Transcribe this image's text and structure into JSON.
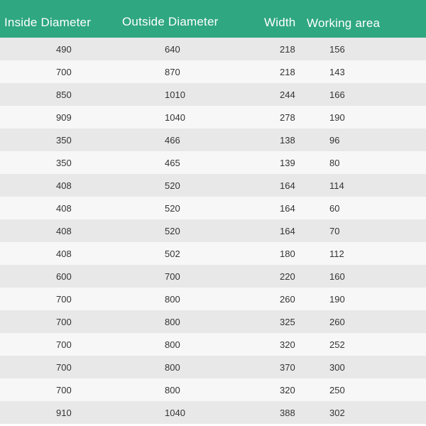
{
  "table": {
    "columns": [
      "Inside Diameter",
      "Outside Diameter",
      "Width",
      "Working area"
    ],
    "rows": [
      [
        "490",
        "640",
        "218",
        "156"
      ],
      [
        "700",
        "870",
        "218",
        "143"
      ],
      [
        "850",
        "1010",
        "244",
        "166"
      ],
      [
        "909",
        "1040",
        "278",
        "190"
      ],
      [
        "350",
        "466",
        "138",
        "96"
      ],
      [
        "350",
        "465",
        "139",
        "80"
      ],
      [
        "408",
        "520",
        "164",
        "114"
      ],
      [
        "408",
        "520",
        "164",
        "60"
      ],
      [
        "408",
        "520",
        "164",
        "70"
      ],
      [
        "408",
        "502",
        "180",
        "112"
      ],
      [
        "600",
        "700",
        "220",
        "160"
      ],
      [
        "700",
        "800",
        "260",
        "190"
      ],
      [
        "700",
        "800",
        "325",
        "260"
      ],
      [
        "700",
        "800",
        "320",
        "252"
      ],
      [
        "700",
        "800",
        "370",
        "300"
      ],
      [
        "700",
        "800",
        "320",
        "250"
      ],
      [
        "910",
        "1040",
        "388",
        "302"
      ]
    ]
  },
  "colors": {
    "header_background": "#2fa781",
    "header_text": "#ffffff",
    "row_odd": "#e8e8e8",
    "row_even": "#f7f7f7",
    "cell_text": "#333333"
  }
}
